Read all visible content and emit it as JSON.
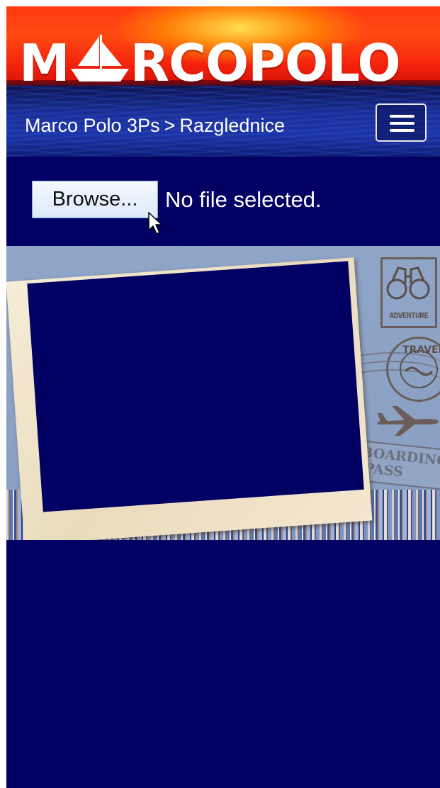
{
  "header": {
    "logo_text_left": "M",
    "logo_text_right": "RCOPOLO",
    "breadcrumb": {
      "items": [
        "Marco Polo 3Ps",
        "Razglednice"
      ],
      "separator": ">"
    },
    "menu_icon": "hamburger-icon"
  },
  "upload": {
    "browse_label": "Browse...",
    "status_text": "No file selected."
  },
  "postcard": {
    "stamp_adventure": "ADVENTURE",
    "stamp_travel": "TRAVEL",
    "boarding_pass_line1": "BOARDING",
    "boarding_pass_line2": "PASS",
    "icons": [
      "binoculars-icon",
      "airplane-icon"
    ]
  },
  "colors": {
    "page_background": "#020163",
    "sky_red": "#ff3a10",
    "sea_blue": "#1a2f9a",
    "text": "#ffffff"
  }
}
